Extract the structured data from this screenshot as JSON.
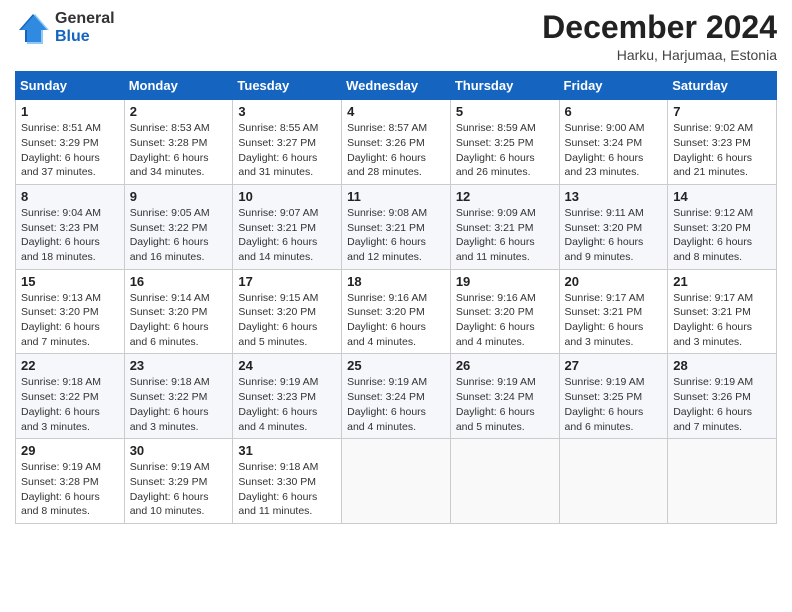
{
  "header": {
    "logo": {
      "general": "General",
      "blue": "Blue"
    },
    "title": "December 2024",
    "subtitle": "Harku, Harjumaa, Estonia"
  },
  "calendar": {
    "weekdays": [
      "Sunday",
      "Monday",
      "Tuesday",
      "Wednesday",
      "Thursday",
      "Friday",
      "Saturday"
    ],
    "weeks": [
      [
        {
          "day": "1",
          "sunrise": "8:51 AM",
          "sunset": "3:29 PM",
          "daylight": "6 hours and 37 minutes."
        },
        {
          "day": "2",
          "sunrise": "8:53 AM",
          "sunset": "3:28 PM",
          "daylight": "6 hours and 34 minutes."
        },
        {
          "day": "3",
          "sunrise": "8:55 AM",
          "sunset": "3:27 PM",
          "daylight": "6 hours and 31 minutes."
        },
        {
          "day": "4",
          "sunrise": "8:57 AM",
          "sunset": "3:26 PM",
          "daylight": "6 hours and 28 minutes."
        },
        {
          "day": "5",
          "sunrise": "8:59 AM",
          "sunset": "3:25 PM",
          "daylight": "6 hours and 26 minutes."
        },
        {
          "day": "6",
          "sunrise": "9:00 AM",
          "sunset": "3:24 PM",
          "daylight": "6 hours and 23 minutes."
        },
        {
          "day": "7",
          "sunrise": "9:02 AM",
          "sunset": "3:23 PM",
          "daylight": "6 hours and 21 minutes."
        }
      ],
      [
        {
          "day": "8",
          "sunrise": "9:04 AM",
          "sunset": "3:23 PM",
          "daylight": "6 hours and 18 minutes."
        },
        {
          "day": "9",
          "sunrise": "9:05 AM",
          "sunset": "3:22 PM",
          "daylight": "6 hours and 16 minutes."
        },
        {
          "day": "10",
          "sunrise": "9:07 AM",
          "sunset": "3:21 PM",
          "daylight": "6 hours and 14 minutes."
        },
        {
          "day": "11",
          "sunrise": "9:08 AM",
          "sunset": "3:21 PM",
          "daylight": "6 hours and 12 minutes."
        },
        {
          "day": "12",
          "sunrise": "9:09 AM",
          "sunset": "3:21 PM",
          "daylight": "6 hours and 11 minutes."
        },
        {
          "day": "13",
          "sunrise": "9:11 AM",
          "sunset": "3:20 PM",
          "daylight": "6 hours and 9 minutes."
        },
        {
          "day": "14",
          "sunrise": "9:12 AM",
          "sunset": "3:20 PM",
          "daylight": "6 hours and 8 minutes."
        }
      ],
      [
        {
          "day": "15",
          "sunrise": "9:13 AM",
          "sunset": "3:20 PM",
          "daylight": "6 hours and 7 minutes."
        },
        {
          "day": "16",
          "sunrise": "9:14 AM",
          "sunset": "3:20 PM",
          "daylight": "6 hours and 6 minutes."
        },
        {
          "day": "17",
          "sunrise": "9:15 AM",
          "sunset": "3:20 PM",
          "daylight": "6 hours and 5 minutes."
        },
        {
          "day": "18",
          "sunrise": "9:16 AM",
          "sunset": "3:20 PM",
          "daylight": "6 hours and 4 minutes."
        },
        {
          "day": "19",
          "sunrise": "9:16 AM",
          "sunset": "3:20 PM",
          "daylight": "6 hours and 4 minutes."
        },
        {
          "day": "20",
          "sunrise": "9:17 AM",
          "sunset": "3:21 PM",
          "daylight": "6 hours and 3 minutes."
        },
        {
          "day": "21",
          "sunrise": "9:17 AM",
          "sunset": "3:21 PM",
          "daylight": "6 hours and 3 minutes."
        }
      ],
      [
        {
          "day": "22",
          "sunrise": "9:18 AM",
          "sunset": "3:22 PM",
          "daylight": "6 hours and 3 minutes."
        },
        {
          "day": "23",
          "sunrise": "9:18 AM",
          "sunset": "3:22 PM",
          "daylight": "6 hours and 3 minutes."
        },
        {
          "day": "24",
          "sunrise": "9:19 AM",
          "sunset": "3:23 PM",
          "daylight": "6 hours and 4 minutes."
        },
        {
          "day": "25",
          "sunrise": "9:19 AM",
          "sunset": "3:24 PM",
          "daylight": "6 hours and 4 minutes."
        },
        {
          "day": "26",
          "sunrise": "9:19 AM",
          "sunset": "3:24 PM",
          "daylight": "6 hours and 5 minutes."
        },
        {
          "day": "27",
          "sunrise": "9:19 AM",
          "sunset": "3:25 PM",
          "daylight": "6 hours and 6 minutes."
        },
        {
          "day": "28",
          "sunrise": "9:19 AM",
          "sunset": "3:26 PM",
          "daylight": "6 hours and 7 minutes."
        }
      ],
      [
        {
          "day": "29",
          "sunrise": "9:19 AM",
          "sunset": "3:28 PM",
          "daylight": "6 hours and 8 minutes."
        },
        {
          "day": "30",
          "sunrise": "9:19 AM",
          "sunset": "3:29 PM",
          "daylight": "6 hours and 10 minutes."
        },
        {
          "day": "31",
          "sunrise": "9:18 AM",
          "sunset": "3:30 PM",
          "daylight": "6 hours and 11 minutes."
        },
        null,
        null,
        null,
        null
      ]
    ],
    "labels": {
      "sunrise": "Sunrise:",
      "sunset": "Sunset:",
      "daylight": "Daylight:"
    }
  }
}
